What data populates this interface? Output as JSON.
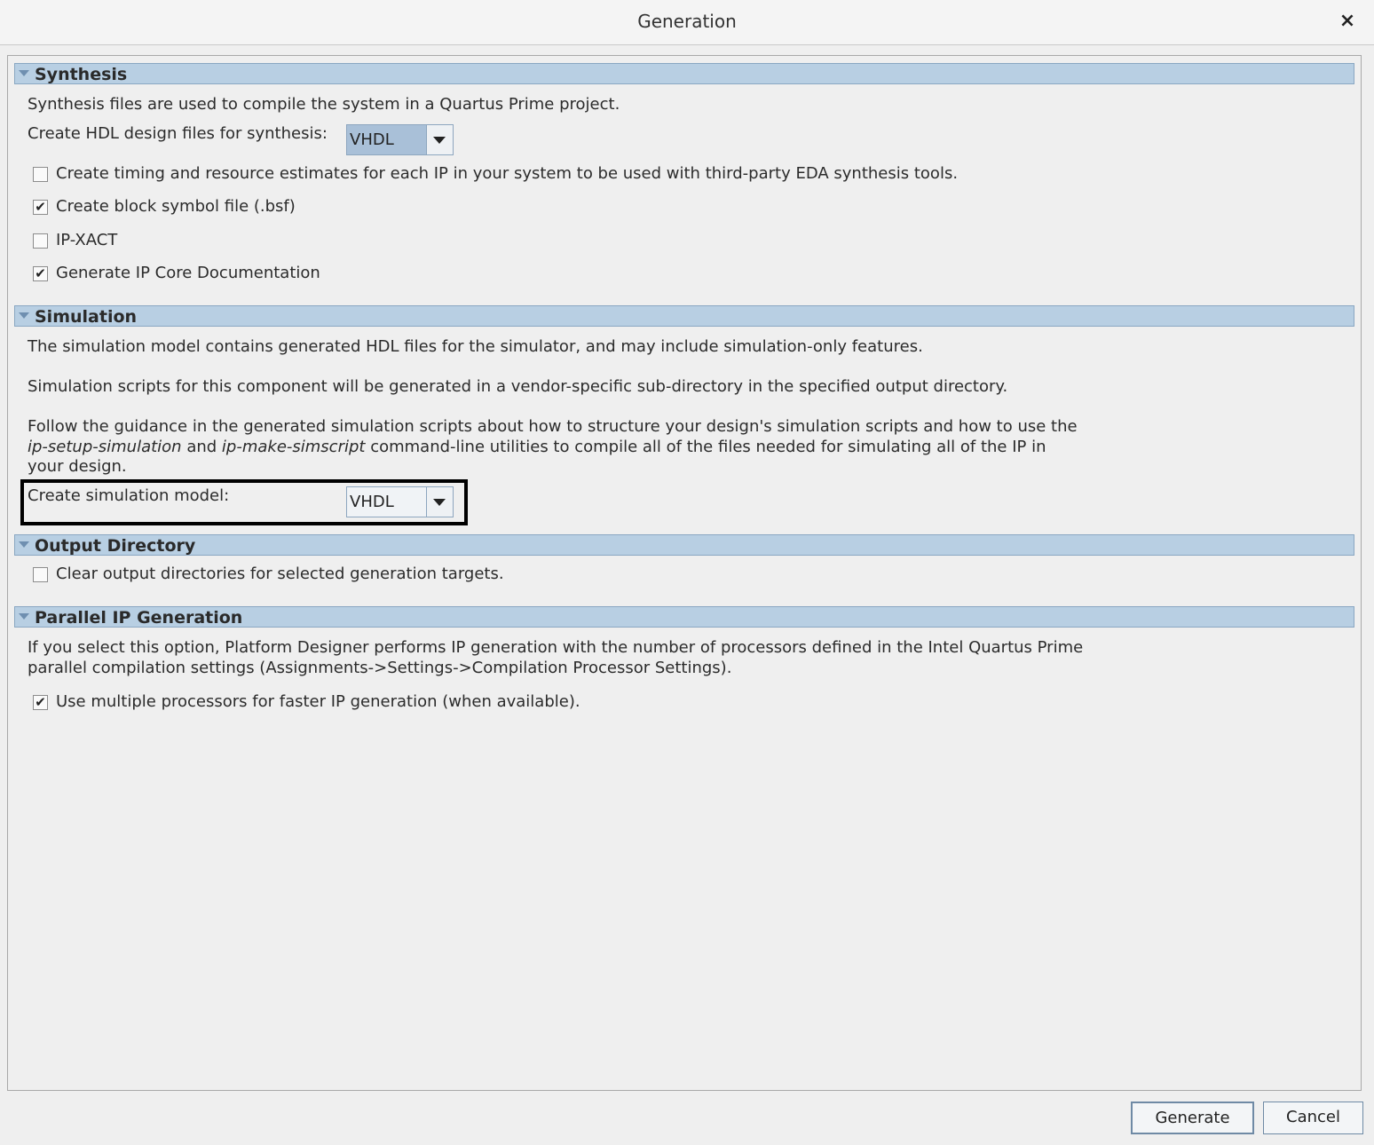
{
  "window": {
    "title": "Generation",
    "close_icon": "×"
  },
  "synthesis": {
    "header": "Synthesis",
    "description": "Synthesis files are used to compile the system in a Quartus Prime project.",
    "hdl_label": "Create HDL design files for synthesis:",
    "hdl_value": "VHDL",
    "options": [
      {
        "label": "Create timing and resource estimates for each IP in your system to be used with third-party EDA synthesis tools.",
        "checked": false
      },
      {
        "label": "Create block symbol file (.bsf)",
        "checked": true
      },
      {
        "label": "IP-XACT",
        "checked": false
      },
      {
        "label": "Generate IP Core Documentation",
        "checked": true
      }
    ]
  },
  "simulation": {
    "header": "Simulation",
    "para1": "The simulation model contains generated HDL files for the simulator, and may include simulation-only features.",
    "para2": "Simulation scripts for this component will be generated in a vendor-specific sub-directory in the specified output directory.",
    "para3_a": "Follow the guidance in the generated simulation scripts about how to structure your design's simulation scripts and how to use the ",
    "para3_tool1": "ip-setup-simulation",
    "para3_b": " and ",
    "para3_tool2": "ip-make-simscript",
    "para3_c": " command-line utilities to compile all of the files needed for simulating all of the IP in your design.",
    "model_label": "Create simulation model:",
    "model_value": "VHDL"
  },
  "output_directory": {
    "header": "Output Directory",
    "option": {
      "label": "Clear output directories for selected generation targets.",
      "checked": false
    }
  },
  "parallel": {
    "header": "Parallel IP Generation",
    "description": "If you select this option, Platform Designer performs IP generation with the number of processors defined in the Intel Quartus Prime parallel compilation settings (Assignments->Settings->Compilation Processor Settings).",
    "option": {
      "label": "Use multiple processors for faster IP generation (when available).",
      "checked": true
    }
  },
  "buttons": {
    "generate": "Generate",
    "cancel": "Cancel"
  },
  "checkmark": "✔"
}
